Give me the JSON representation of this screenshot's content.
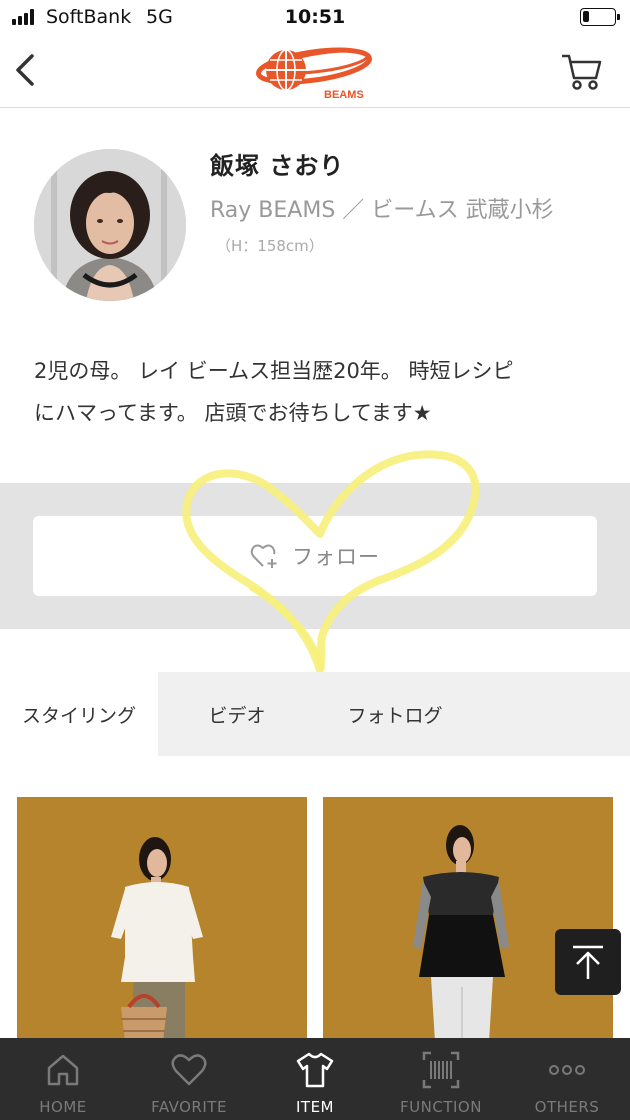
{
  "status_bar": {
    "carrier": "SoftBank",
    "network": "5G",
    "time": "10:51",
    "battery_level": 0.2
  },
  "header": {
    "back_icon": "chevron-left-icon",
    "logo_text": "BEAMS",
    "cart_icon": "cart-icon",
    "brand_color": "#e8562a"
  },
  "profile": {
    "name": "飯塚 さおり",
    "affiliation": "Ray BEAMS ／ ビームス 武蔵小杉",
    "height": "（H：158cm）",
    "bio_line1": "2児の母。 レイ ビームス担当歴20年。 時短レシピ",
    "bio_line2": "にハマってます。 店頭でお待ちしてます★"
  },
  "follow": {
    "label": "フォロー",
    "icon": "heart-plus-icon"
  },
  "tabs": [
    {
      "label": "スタイリング",
      "active": true
    },
    {
      "label": "ビデオ",
      "active": false
    },
    {
      "label": "フォトログ",
      "active": false
    }
  ],
  "styling_thumbnails": [
    "styling-photo-1",
    "styling-photo-2"
  ],
  "back_to_top_icon": "arrow-up-icon",
  "bottom_nav": [
    {
      "label": "HOME",
      "icon": "home-icon",
      "active": false
    },
    {
      "label": "FAVORITE",
      "icon": "heart-icon",
      "active": false
    },
    {
      "label": "ITEM",
      "icon": "tshirt-icon",
      "active": true
    },
    {
      "label": "FUNCTION",
      "icon": "barcode-icon",
      "active": false
    },
    {
      "label": "OTHERS",
      "icon": "more-icon",
      "active": false
    }
  ],
  "colors": {
    "highlight_scribble": "#f6f07a",
    "thumbnail_background": "#b5842c",
    "bottom_nav_background": "#2d2d2d"
  }
}
